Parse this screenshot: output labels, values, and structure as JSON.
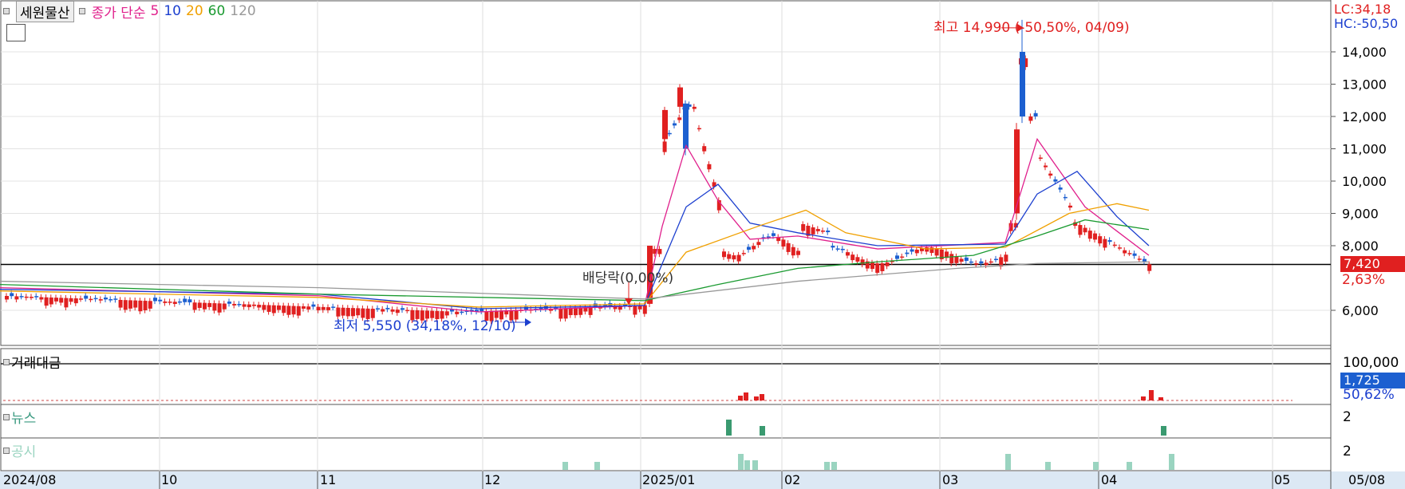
{
  "header": {
    "stock_name": "세원물산",
    "ma_title": "종가 단순",
    "ma_periods": [
      "5",
      "10",
      "20",
      "60",
      "120"
    ],
    "ma_colors": [
      "#e0208c",
      "#1c3fcf",
      "#f0a000",
      "#1a9a30",
      "#999999"
    ]
  },
  "price_panel": {
    "lc_text": "LC:34,18",
    "hc_text": "HC:-50,50",
    "current_price": "7,420",
    "change_pct": "2,63%",
    "high_note": "최고 14,990 (-50,50%, 04/09)",
    "low_note": "최저 5,550 (34,18%, 12/10)",
    "dividend_note": "배당락(0,00%)",
    "y_ticks": [
      "14,000",
      "13,000",
      "12,000",
      "11,000",
      "10,000",
      "9,000",
      "8,000",
      "6,000"
    ]
  },
  "volume_panel": {
    "title": "거래대금",
    "top_label": "100,000",
    "current": "1,725",
    "pct": "50,62%"
  },
  "news_panel": {
    "title": "뉴스",
    "label": "2"
  },
  "disclosure_panel": {
    "title": "공시",
    "label": "2"
  },
  "x_axis": {
    "labels": [
      "2024/08",
      "10",
      "11",
      "12",
      "2025/01",
      "02",
      "03",
      "04",
      "05"
    ],
    "end_label": "05/08"
  },
  "chart_data": {
    "type": "candlestick",
    "y_ticks": [
      6000,
      8000,
      9000,
      10000,
      11000,
      12000,
      13000,
      14000
    ],
    "reference_price": 7420,
    "annotations": [
      "최고 14,990 (-50,50%, 04/09)",
      "최저 5,550 (34,18%, 12/10)",
      "배당락(0,00%)"
    ],
    "high": 14990,
    "low": 5550,
    "last_close": 7420
  }
}
